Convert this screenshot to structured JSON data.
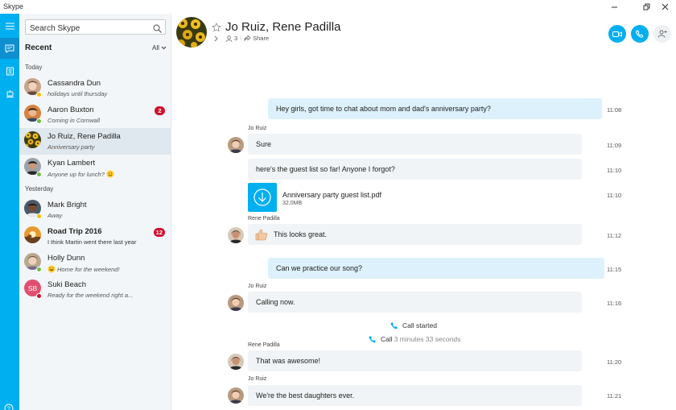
{
  "window": {
    "title": "Skype"
  },
  "colors": {
    "accent": "#00aff0",
    "rail_active": "#0d8fd0",
    "unread_badge": "#d10f2d",
    "presence_online": "#6cbd45",
    "presence_away": "#ffb900",
    "presence_busy": "#d10f2d"
  },
  "rail": {
    "items": [
      "chat-icon",
      "contacts-icon",
      "bot-icon",
      "help-icon"
    ]
  },
  "search": {
    "placeholder": "Search Skype"
  },
  "sidebar": {
    "recent_label": "Recent",
    "filter": "All",
    "groups": [
      {
        "label": "Today",
        "contacts": [
          {
            "name": "Cassandra Dun",
            "status": "holidays until thursday",
            "presence": "away"
          },
          {
            "name": "Aaron Buxton",
            "status": "Coming in Cornwall",
            "presence": "online",
            "unread": "2"
          },
          {
            "name": "Jo Ruiz, Rene Padilla",
            "status": "Anniversary party",
            "selected": true
          },
          {
            "name": "Kyan Lambert",
            "status": "Anyone up for lunch?",
            "presence": "online"
          }
        ]
      },
      {
        "label": "Yesterday",
        "contacts": [
          {
            "name": "Mark Bright",
            "status": "Away",
            "presence": "away"
          },
          {
            "name": "Road Trip 2016",
            "status": "I think Martin went there last year",
            "unread": "12"
          },
          {
            "name": "Holly Dunn",
            "status": "Home for the weekend!",
            "presence": "online"
          },
          {
            "name": "Suki Beach",
            "status": "Ready for the weekend right a...",
            "presence": "busy",
            "initials": "SB"
          }
        ]
      }
    ]
  },
  "conversation": {
    "title": "Jo Ruiz, Rene Padilla",
    "participants": "3",
    "share_label": "Share"
  },
  "messages": [
    {
      "type": "out",
      "text": "Hey girls, got time to chat about mom and dad's anniversary party?",
      "time": "11:08"
    },
    {
      "type": "in",
      "sender": "Jo Ruiz",
      "text": "Sure",
      "time": "11:09"
    },
    {
      "type": "in",
      "text": "here's the guest list so far! Anyone I forgot?",
      "time": "11:10"
    },
    {
      "type": "file",
      "file_name": "Anniversary party guest list.pdf",
      "file_size": "32.0MB",
      "time": "11:10"
    },
    {
      "type": "in",
      "sender": "Rene Padilla",
      "text": "This looks great.",
      "time": "11:12"
    },
    {
      "type": "out",
      "text": "Can we practice our song?",
      "time": "11:15"
    },
    {
      "type": "in",
      "sender": "Jo Ruiz",
      "text": "Calling now.",
      "time": "11:16"
    },
    {
      "type": "system",
      "text": "Call started"
    },
    {
      "type": "system",
      "text": "Call",
      "detail": "3 minutes 33 seconds"
    },
    {
      "type": "in",
      "sender": "Rene Padilla",
      "text": "That was awesome!",
      "time": "11:20"
    },
    {
      "type": "in",
      "sender": "Jo Ruiz",
      "text": "We're the best daughters ever.",
      "time": "11:21"
    }
  ]
}
